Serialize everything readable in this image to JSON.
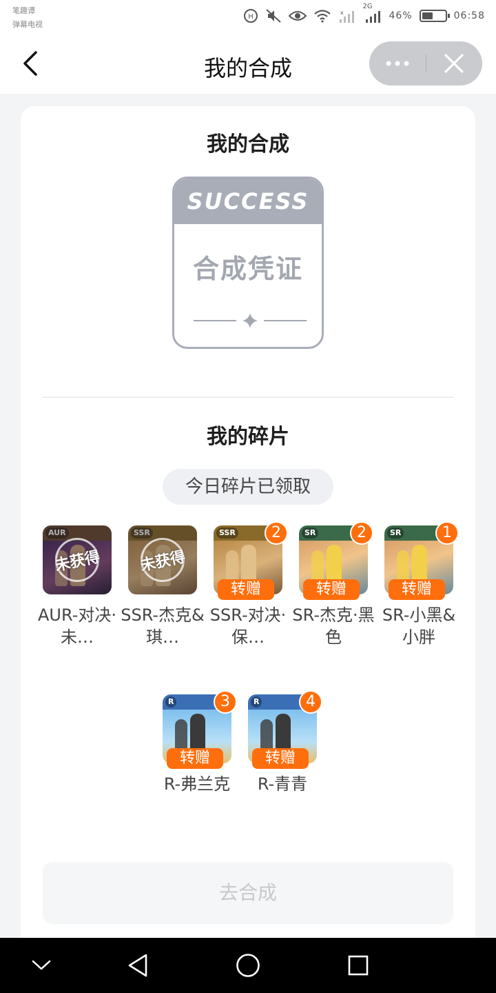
{
  "status_bar": {
    "carrier_line1": "笔趣谭",
    "carrier_line2": "弹幕电视",
    "battery_text": "46%",
    "battery_level": 0.46,
    "time": "06:58",
    "network_label": "2G",
    "icons": [
      "hd-call-icon",
      "mute-icon",
      "eye-icon",
      "wifi-icon",
      "signal-icon",
      "signal-2g-icon",
      "battery-icon"
    ]
  },
  "nav": {
    "title": "我的合成",
    "back_icon": "chevron-left-icon",
    "more_icon": "more-dots-icon",
    "close_icon": "close-icon"
  },
  "synthesis": {
    "title": "我的合成",
    "voucher_header": "SUCCESS",
    "voucher_text": "合成凭证"
  },
  "fragments": {
    "title": "我的碎片",
    "daily_status": "今日碎片已领取",
    "items": [
      {
        "name": "AUR-对决·未…",
        "tier": "AUR",
        "owned": false,
        "locked_label": "未获得",
        "count": null,
        "action": ""
      },
      {
        "name": "SSR-杰克&琪…",
        "tier": "SSR",
        "owned": false,
        "locked_label": "未获得",
        "count": null,
        "action": ""
      },
      {
        "name": "SSR-对决·保…",
        "tier": "SSR",
        "owned": true,
        "locked_label": "",
        "count": "2",
        "action": "转赠"
      },
      {
        "name": "SR-杰克·黑色",
        "tier": "SR",
        "owned": true,
        "locked_label": "",
        "count": "2",
        "action": "转赠"
      },
      {
        "name": "SR-小黑&小胖",
        "tier": "SR",
        "owned": true,
        "locked_label": "",
        "count": "1",
        "action": "转赠"
      },
      {
        "name": "R-弗兰克",
        "tier": "R",
        "owned": true,
        "locked_label": "",
        "count": "3",
        "action": "转赠"
      },
      {
        "name": "R-青青",
        "tier": "R",
        "owned": true,
        "locked_label": "",
        "count": "4",
        "action": "转赠"
      }
    ]
  },
  "footer": {
    "synthesize_label": "去合成",
    "synthesize_enabled": false
  },
  "system_nav": {
    "icons": [
      "hide-chevron-icon",
      "back-triangle-icon",
      "home-circle-icon",
      "recents-square-icon"
    ]
  },
  "colors": {
    "accent": "#ff6e0d",
    "voucher_gray": "#a8adb8",
    "disabled_text": "#c7c9cd"
  }
}
